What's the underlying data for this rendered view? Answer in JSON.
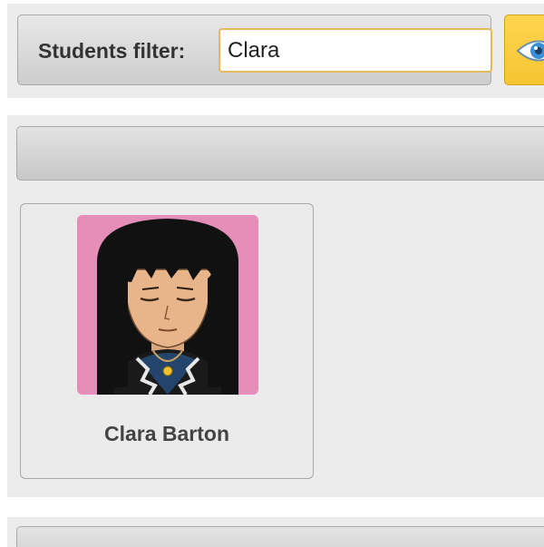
{
  "filter": {
    "label": "Students filter:",
    "value": "Clara",
    "view_icon": "eye-icon"
  },
  "students": [
    {
      "name": "Clara Barton",
      "avatar_icon": "student-avatar"
    }
  ],
  "colors": {
    "button_accent": "#f5c531",
    "input_border": "#e8b95c",
    "avatar_background": "#e58fb8",
    "panel_background": "#ececec"
  }
}
